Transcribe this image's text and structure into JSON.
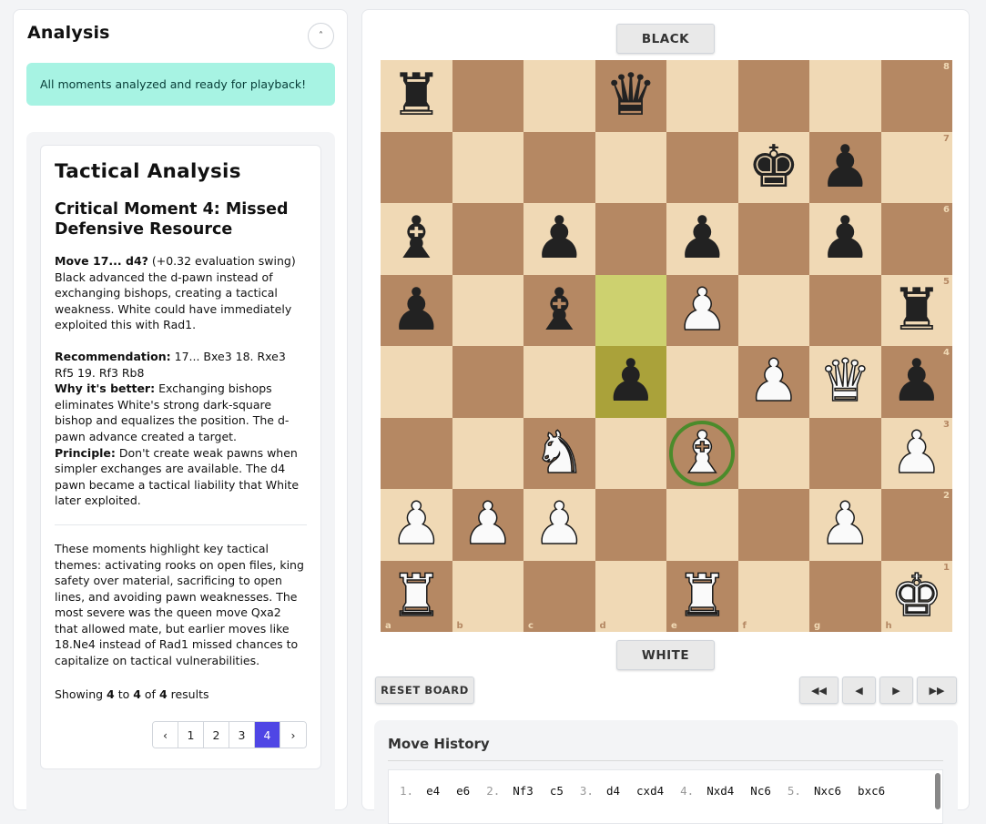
{
  "analysis": {
    "title": "Analysis",
    "collapse_glyph": "˄",
    "alert": "All moments analyzed and ready for playback!",
    "card_title": "Tactical Analysis",
    "moment_title": "Critical Moment 4: Missed Defensive Resource",
    "move_label": "Move 17... d4?",
    "move_swing": " (+0.32 evaluation swing)",
    "move_desc": "Black advanced the d-pawn instead of exchanging bishops, creating a tactical weakness. White could have immediately exploited this with Rad1.",
    "rec_label": "Recommendation:",
    "rec_text": " 17... Bxe3 18. Rxe3 Rf5 19. Rf3 Rb8",
    "why_label": "Why it's better:",
    "why_text": " Exchanging bishops eliminates White's strong dark-square bishop and equalizes the position. The d-pawn advance created a target.",
    "principle_label": "Principle:",
    "principle_text": " Don't create weak pawns when simpler exchanges are available. The d4 pawn became a tactical liability that White later exploited.",
    "summary": "These moments highlight key tactical themes: activating rooks on open files, king safety over material, sacrificing to open lines, and avoiding pawn weaknesses. The most severe was the queen move Qxa2 that allowed mate, but earlier moves like 18.Ne4 instead of Rad1 missed chances to capitalize on tactical vulnerabilities.",
    "showing": {
      "prefix": "Showing ",
      "from": "4",
      "to_word": " to ",
      "to": "4",
      "of_word": " of ",
      "total": "4",
      "suffix": " results"
    },
    "pagination": {
      "prev": "‹",
      "pages": [
        "1",
        "2",
        "3",
        "4"
      ],
      "active": "4",
      "next": "›"
    }
  },
  "board": {
    "top_player": "BLACK",
    "bottom_player": "WHITE",
    "files": [
      "a",
      "b",
      "c",
      "d",
      "e",
      "f",
      "g",
      "h"
    ],
    "ranks": [
      "8",
      "7",
      "6",
      "5",
      "4",
      "3",
      "2",
      "1"
    ],
    "rows": [
      [
        "br",
        "",
        "",
        "bq",
        "",
        "",
        "",
        ""
      ],
      [
        "",
        "",
        "",
        "",
        "",
        "bk",
        "bp",
        ""
      ],
      [
        "bb",
        "",
        "bp",
        "",
        "bp",
        "",
        "bp",
        ""
      ],
      [
        "bp",
        "",
        "bb",
        "",
        "wp",
        "",
        "",
        "br"
      ],
      [
        "",
        "",
        "",
        "bp",
        "",
        "wp",
        "wq",
        "bp"
      ],
      [
        "",
        "",
        "wn",
        "",
        "wb",
        "",
        "",
        "wp"
      ],
      [
        "wp",
        "wp",
        "wp",
        "",
        "",
        "",
        "wp",
        ""
      ],
      [
        "wr",
        "",
        "",
        "",
        "wr",
        "",
        "",
        "wk"
      ]
    ],
    "highlight_squares": [
      "d5",
      "d4"
    ],
    "marked_square": "e3",
    "colors": {
      "light": "#f0d9b5",
      "dark": "#b58863",
      "highlight_light": "#cdd16f",
      "highlight_dark": "#aaa23a",
      "ring": "#4b8b2b"
    }
  },
  "controls": {
    "reset": "RESET BOARD",
    "first": "◀◀",
    "prev": "◀",
    "next": "▶",
    "last": "▶▶"
  },
  "history": {
    "title": "Move History",
    "moves": [
      {
        "n": "1.",
        "w": "e4",
        "b": "e6"
      },
      {
        "n": "2.",
        "w": "Nf3",
        "b": "c5"
      },
      {
        "n": "3.",
        "w": "d4",
        "b": "cxd4"
      },
      {
        "n": "4.",
        "w": "Nxd4",
        "b": "Nc6"
      },
      {
        "n": "5.",
        "w": "Nxc6",
        "b": "bxc6"
      }
    ]
  }
}
